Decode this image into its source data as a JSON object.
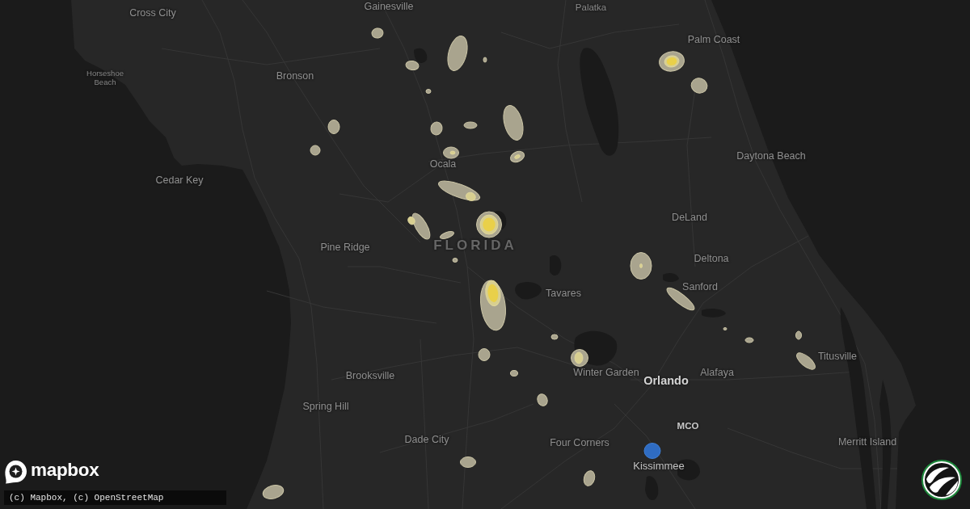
{
  "map": {
    "labels": [
      {
        "text": "Cross City",
        "kind": "town"
      },
      {
        "text": "Gainesville",
        "kind": "town"
      },
      {
        "text": "Palatka",
        "kind": "minor"
      },
      {
        "text": "Palm Coast",
        "kind": "town"
      },
      {
        "text": "Horseshoe Beach",
        "kind": "village"
      },
      {
        "text": "Bronson",
        "kind": "town"
      },
      {
        "text": "Ocala",
        "kind": "town"
      },
      {
        "text": "Daytona Beach",
        "kind": "town"
      },
      {
        "text": "Cedar Key",
        "kind": "town"
      },
      {
        "text": "DeLand",
        "kind": "town"
      },
      {
        "text": "Pine Ridge",
        "kind": "town"
      },
      {
        "text": "FLORIDA",
        "kind": "state"
      },
      {
        "text": "Deltona",
        "kind": "town"
      },
      {
        "text": "Tavares",
        "kind": "town"
      },
      {
        "text": "Sanford",
        "kind": "town"
      },
      {
        "text": "Titusville",
        "kind": "town"
      },
      {
        "text": "Brooksville",
        "kind": "town"
      },
      {
        "text": "Winter Garden",
        "kind": "town"
      },
      {
        "text": "Orlando",
        "kind": "major"
      },
      {
        "text": "Alafaya",
        "kind": "town"
      },
      {
        "text": "Spring Hill",
        "kind": "town"
      },
      {
        "text": "MCO",
        "kind": "airport"
      },
      {
        "text": "Dade City",
        "kind": "town"
      },
      {
        "text": "Four Corners",
        "kind": "town"
      },
      {
        "text": "Merritt Island",
        "kind": "town"
      },
      {
        "text": "Kissimmee",
        "kind": "city"
      }
    ]
  },
  "branding": {
    "wordmark": "mapbox"
  },
  "attribution": "(c) Mapbox, (c) OpenStreetMap"
}
